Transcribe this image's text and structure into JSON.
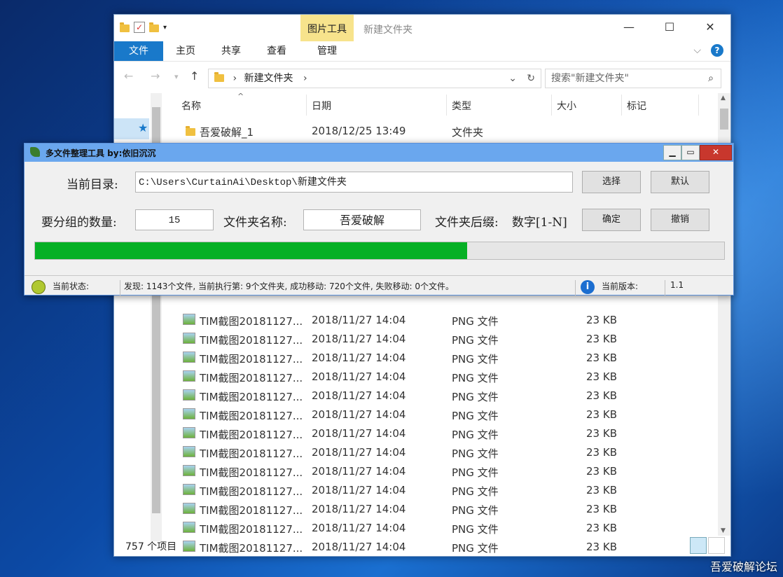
{
  "explorer": {
    "title": "新建文件夹",
    "context_tab": "图片工具",
    "ribbon_tabs": [
      "文件",
      "主页",
      "共享",
      "查看",
      "管理"
    ],
    "address_path": "新建文件夹",
    "search_placeholder": "搜索\"新建文件夹\"",
    "columns": [
      "名称",
      "日期",
      "类型",
      "大小",
      "标记"
    ],
    "folder_row": {
      "name": "吾爱破解_1",
      "date": "2018/12/25 13:49",
      "type": "文件夹"
    },
    "file_rows": [
      {
        "name": "TIM截图20181127...",
        "date": "2018/11/27 14:04",
        "type": "PNG 文件",
        "size": "23 KB"
      },
      {
        "name": "TIM截图20181127...",
        "date": "2018/11/27 14:04",
        "type": "PNG 文件",
        "size": "23 KB"
      },
      {
        "name": "TIM截图20181127...",
        "date": "2018/11/27 14:04",
        "type": "PNG 文件",
        "size": "23 KB"
      },
      {
        "name": "TIM截图20181127...",
        "date": "2018/11/27 14:04",
        "type": "PNG 文件",
        "size": "23 KB"
      },
      {
        "name": "TIM截图20181127...",
        "date": "2018/11/27 14:04",
        "type": "PNG 文件",
        "size": "23 KB"
      },
      {
        "name": "TIM截图20181127...",
        "date": "2018/11/27 14:04",
        "type": "PNG 文件",
        "size": "23 KB"
      },
      {
        "name": "TIM截图20181127...",
        "date": "2018/11/27 14:04",
        "type": "PNG 文件",
        "size": "23 KB"
      },
      {
        "name": "TIM截图20181127...",
        "date": "2018/11/27 14:04",
        "type": "PNG 文件",
        "size": "23 KB"
      },
      {
        "name": "TIM截图20181127...",
        "date": "2018/11/27 14:04",
        "type": "PNG 文件",
        "size": "23 KB"
      },
      {
        "name": "TIM截图20181127...",
        "date": "2018/11/27 14:04",
        "type": "PNG 文件",
        "size": "23 KB"
      },
      {
        "name": "TIM截图20181127...",
        "date": "2018/11/27 14:04",
        "type": "PNG 文件",
        "size": "23 KB"
      },
      {
        "name": "TIM截图20181127...",
        "date": "2018/11/27 14:04",
        "type": "PNG 文件",
        "size": "23 KB"
      },
      {
        "name": "TIM截图20181127...",
        "date": "2018/11/27 14:04",
        "type": "PNG 文件",
        "size": "23 KB"
      }
    ],
    "status_count": "757 个项目"
  },
  "tool": {
    "title": "多文件整理工具 by:依旧沉沉",
    "dir_label": "当前目录:",
    "dir_value": "C:\\Users\\CurtainAi\\Desktop\\新建文件夹",
    "select_button": "选择",
    "default_button": "默认",
    "group_label": "要分组的数量:",
    "group_value": "15",
    "folder_name_label": "文件夹名称:",
    "folder_name_value": "吾爱破解",
    "suffix_label": "文件夹后缀:",
    "suffix_value": "数字[1-N]",
    "confirm_button": "确定",
    "cancel_button": "撤销",
    "progress": 0.627,
    "status_label": "当前状态:",
    "status_text": "发现: 1143个文件, 当前执行第: 9个文件夹, 成功移动: 720个文件, 失败移动: 0个文件。",
    "version_label": "当前版本:",
    "version_value": "1.1"
  },
  "watermark": "吾爱破解论坛",
  "colors": {
    "accent": "#1979ca",
    "progress": "#06b025",
    "tool_title": "#6aa7ee",
    "close": "#c8372d"
  }
}
